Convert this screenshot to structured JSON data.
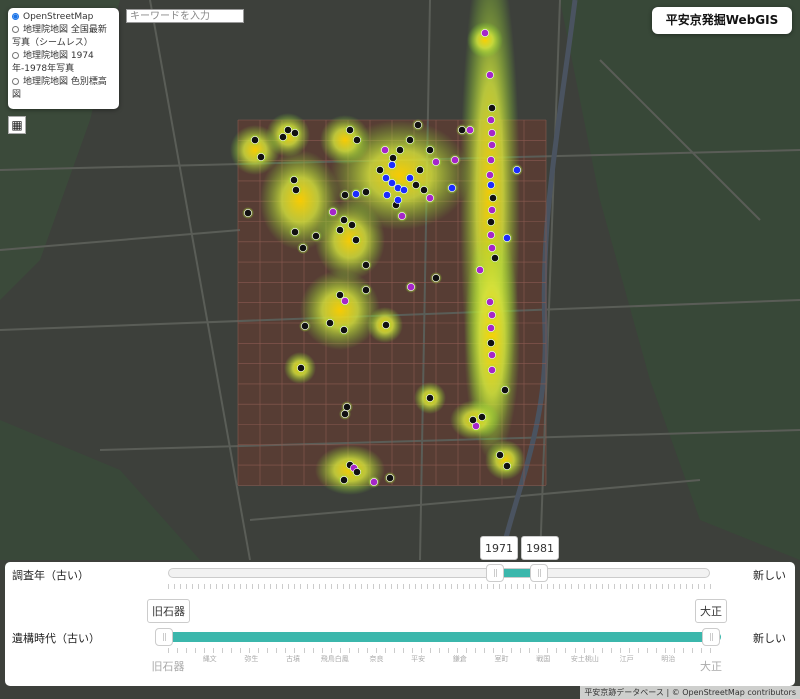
{
  "layers": {
    "items": [
      {
        "label": "OpenStreetMap",
        "selected": true
      },
      {
        "label": "地理院地図 全国最新写真（シームレス）",
        "selected": false
      },
      {
        "label": "地理院地図 1974年-1978年写真",
        "selected": false
      },
      {
        "label": "地理院地図 色別標高図",
        "selected": false
      }
    ]
  },
  "search": {
    "placeholder": "キーワードを入力"
  },
  "app": {
    "title": "平安京発掘WebGIS"
  },
  "survey_year": {
    "label": "調査年（古い）",
    "right_label": "新しい",
    "from": "1971",
    "to": "1981"
  },
  "period": {
    "label": "遺構時代（古い）",
    "right_label": "新しい",
    "from": "旧石器",
    "to": "大正",
    "eras": [
      "縄文",
      "弥生",
      "古墳",
      "飛鳥白鳳",
      "奈良",
      "平安",
      "鎌倉",
      "室町",
      "戦国",
      "安土桃山",
      "江戸",
      "明治"
    ],
    "start_label": "旧石器",
    "end_label": "大正"
  },
  "attribution": "平安京跡データベース | © OpenStreetMap contributors",
  "colors": {
    "accent": "#3bb7ac",
    "site_black": "#111111",
    "site_blue": "#1b2cff",
    "site_purple": "#a526c9",
    "grid": "#7a3a2e"
  }
}
